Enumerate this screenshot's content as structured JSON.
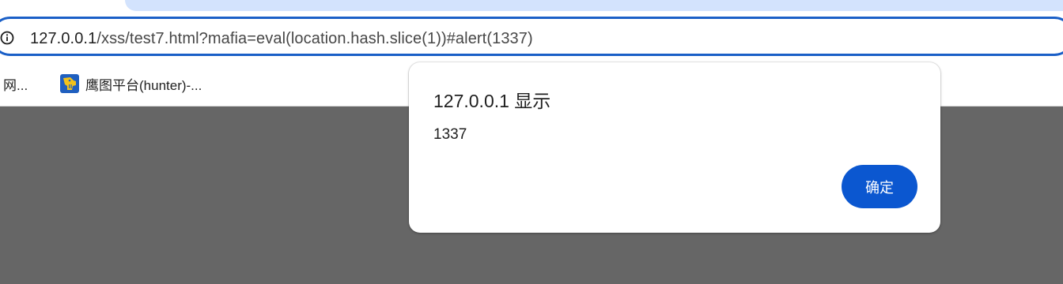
{
  "browser": {
    "address_bar": {
      "host": "127.0.0.1",
      "path": "/xss/test7.html?mafia=eval(location.hash.slice(1))#alert(1337)"
    },
    "bookmarks": [
      {
        "label": "网...",
        "icon": "folder-icon"
      },
      {
        "label": "鹰图平台(hunter)-...",
        "icon": "hunter-logo-icon"
      }
    ]
  },
  "alert_dialog": {
    "title": "127.0.0.1 显示",
    "message": "1337",
    "ok_label": "确定"
  },
  "colors": {
    "accent": "#0b57d0",
    "omnibox_border": "#1a5fc7",
    "page_background": "#666666",
    "tab_strip": "#d3e3fd"
  }
}
